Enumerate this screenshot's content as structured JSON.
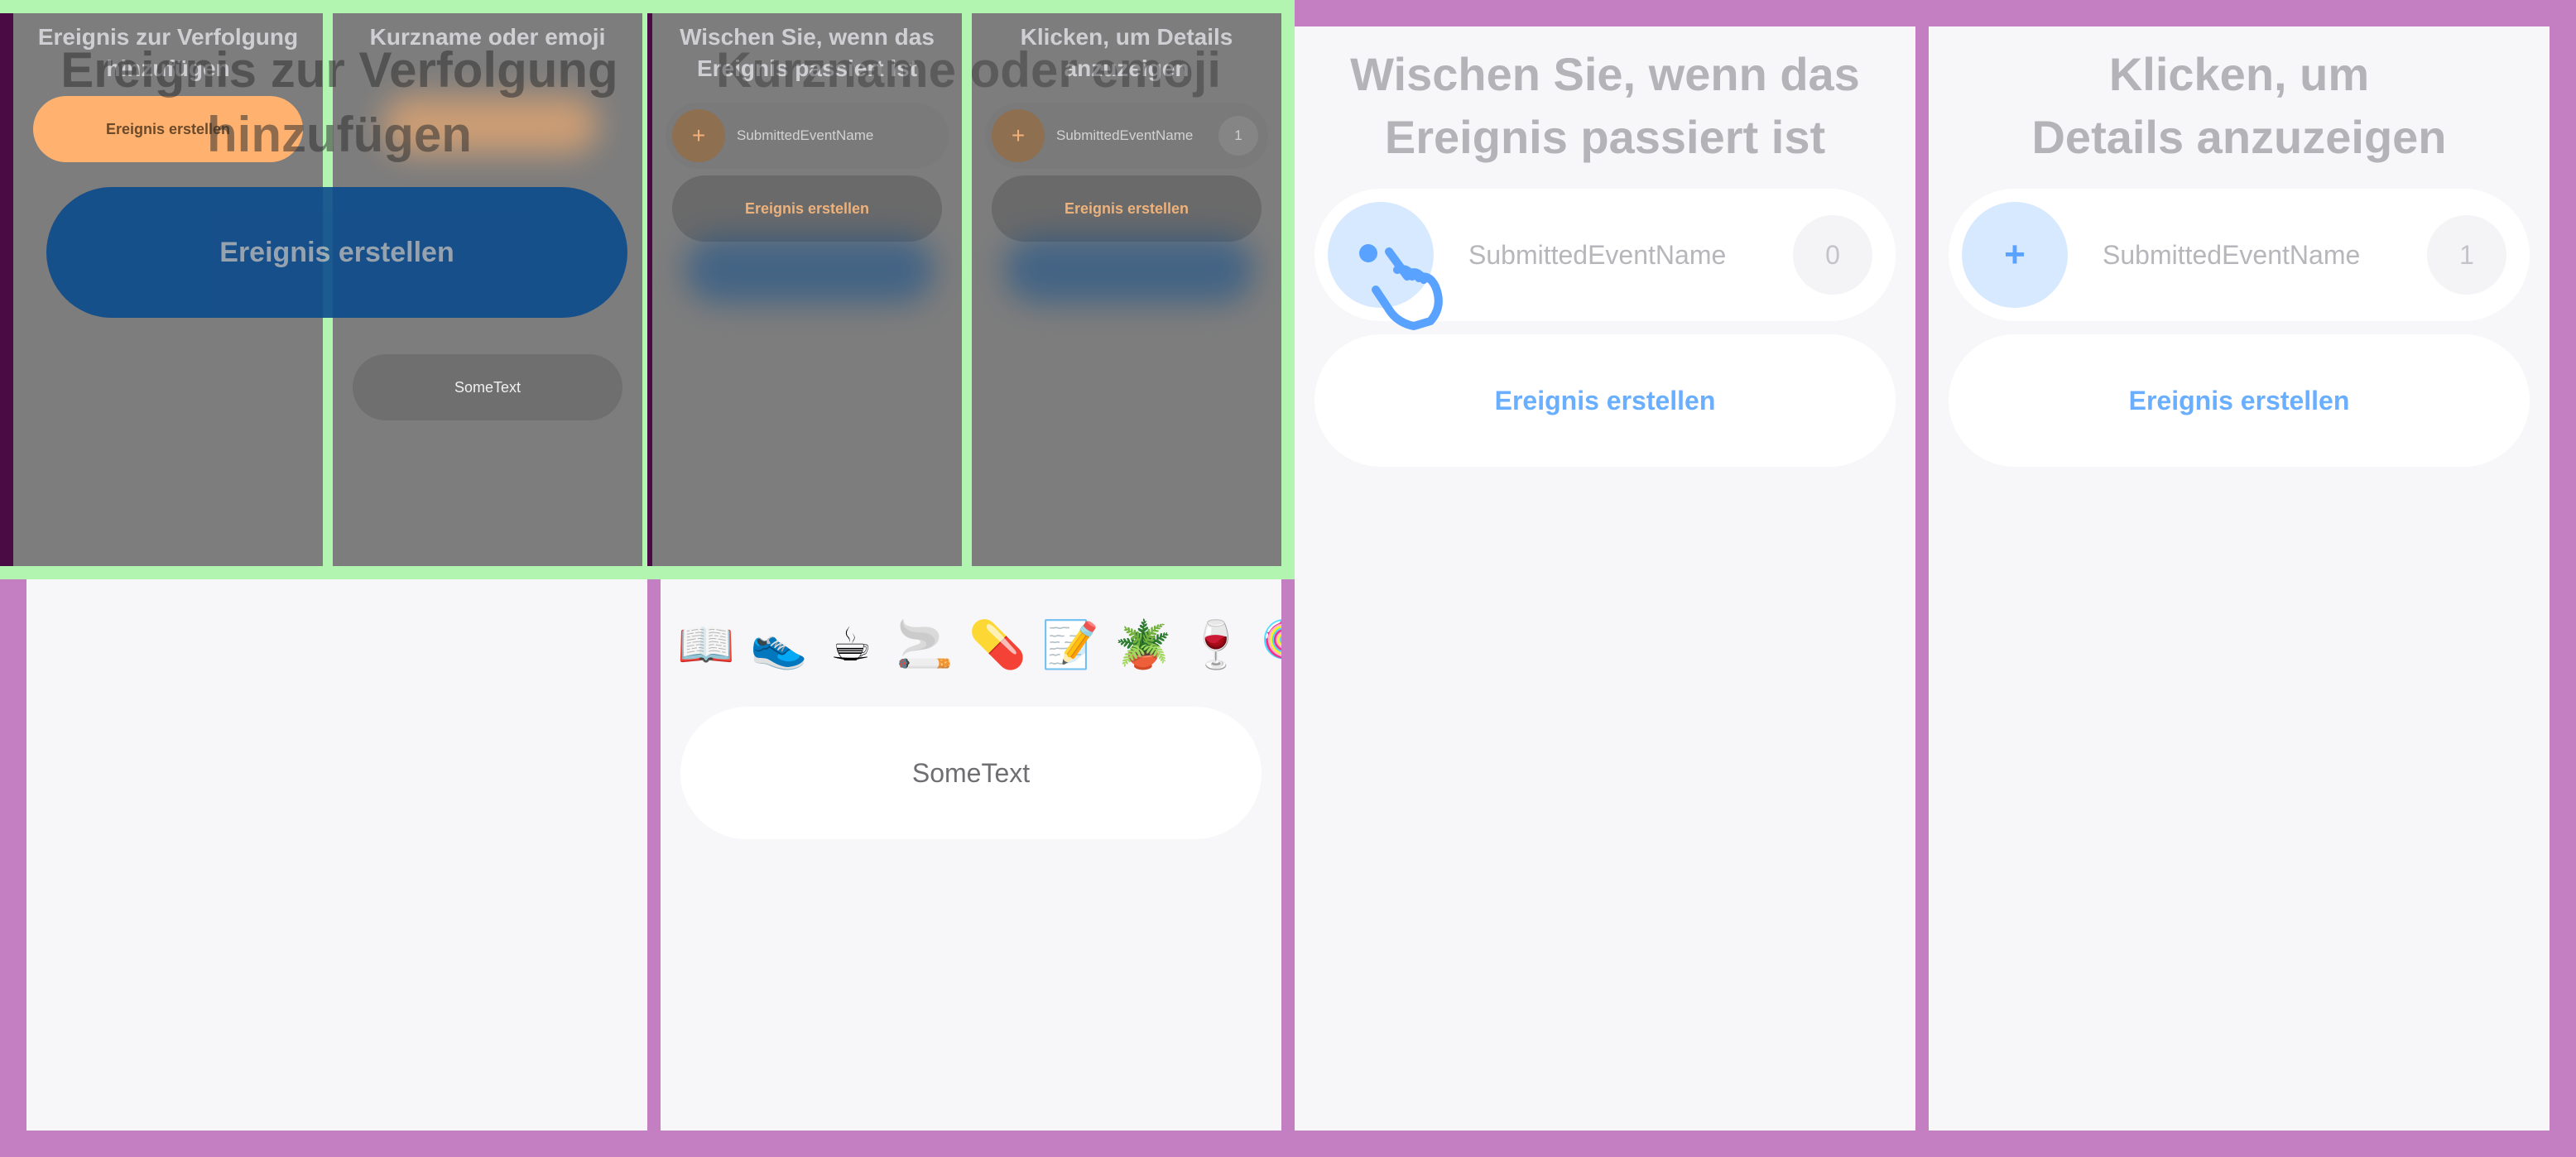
{
  "panels": {
    "p1": {
      "title": "Ereignis zur Verfolgung hinzufügen",
      "button": "Ereignis erstellen"
    },
    "p2": {
      "title": "Kurzname oder emoji",
      "emojis": [
        "📖",
        "👟",
        "☕",
        "🚬",
        "💊",
        "📝",
        "🪴",
        "🍷",
        "🍭"
      ],
      "input_value": "SomeText"
    },
    "p3": {
      "title_line1": "Wischen Sie, wenn das",
      "title_line2": "Ereignis passiert ist",
      "event_name": "SubmittedEventName",
      "count": "0",
      "button": "Ereignis erstellen"
    },
    "p4": {
      "title_line1": "Klicken, um",
      "title_line2": "Details anzuzeigen",
      "action_icon": "+",
      "event_name": "SubmittedEventName",
      "count": "1",
      "button": "Ereignis erstellen"
    }
  },
  "overlay": {
    "m1": {
      "title": "Ereignis zur Verfolgung hinzufügen",
      "button": "Ereignis erstellen"
    },
    "m2": {
      "title": "Kurzname oder emoji",
      "input_value": "SomeText"
    },
    "m3": {
      "title": "Wischen Sie, wenn das Ereignis passiert ist",
      "action_icon": "+",
      "event_name": "SubmittedEventName",
      "button": "Ereignis erstellen"
    },
    "m4": {
      "title": "Klicken, um Details anzuzeigen",
      "action_icon": "+",
      "event_name": "SubmittedEventName",
      "count": "1",
      "button": "Ereignis erstellen"
    },
    "big_title_left": "Ereignis zur Verfolgung hinzufügen",
    "big_button": "Ereignis erstellen",
    "big_title_right": "Kurzname oder emoji"
  },
  "colors": {
    "frame": "#c37fc1",
    "accent_blue": "#6aaeff",
    "accent_orange": "#ffb26f",
    "overlay_green": "#b2f5b1",
    "dark_blue": "#0b4b8c"
  }
}
